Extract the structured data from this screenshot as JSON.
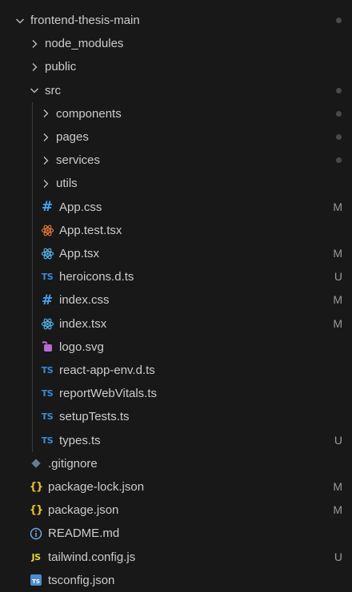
{
  "explorer": {
    "colors": {
      "background": "#181818",
      "text": "#cccccc",
      "badge": "#9a9a9a",
      "dot": "#4a4a4a",
      "css_icon": "#42a5f5",
      "react_icon": "#52b7e8",
      "test_icon": "#e8773b",
      "ts_icon": "#3a8ad8",
      "json_icon": "#e6c232",
      "svg_icon": "#b76ad2",
      "git_icon": "#6a7c8c",
      "js_icon": "#e8d43a",
      "info_icon": "#6fa8dc",
      "tsconfig_icon": "#4a8ccf"
    },
    "items": [
      {
        "label": "frontend-thesis-main",
        "kind": "folder-open",
        "icon": "chevron-down-icon",
        "depth": 0,
        "dot": true
      },
      {
        "label": "node_modules",
        "kind": "folder",
        "icon": "chevron-right-icon",
        "depth": 1
      },
      {
        "label": "public",
        "kind": "folder",
        "icon": "chevron-right-icon",
        "depth": 1
      },
      {
        "label": "src",
        "kind": "folder-open",
        "icon": "chevron-down-icon",
        "depth": 1,
        "dot": true
      },
      {
        "label": "components",
        "kind": "folder",
        "icon": "chevron-right-icon",
        "depth": 2,
        "dot": true
      },
      {
        "label": "pages",
        "kind": "folder",
        "icon": "chevron-right-icon",
        "depth": 2,
        "dot": true
      },
      {
        "label": "services",
        "kind": "folder",
        "icon": "chevron-right-icon",
        "depth": 2,
        "dot": true
      },
      {
        "label": "utils",
        "kind": "folder",
        "icon": "chevron-right-icon",
        "depth": 2
      },
      {
        "label": "App.css",
        "kind": "file",
        "icon": "css-hash-icon",
        "glyph": "#",
        "depth": 2,
        "badge": "M"
      },
      {
        "label": "App.test.tsx",
        "kind": "file",
        "icon": "react-test-icon",
        "glyph": "",
        "depth": 2
      },
      {
        "label": "App.tsx",
        "kind": "file",
        "icon": "react-icon",
        "glyph": "",
        "depth": 2,
        "badge": "M"
      },
      {
        "label": "heroicons.d.ts",
        "kind": "file",
        "icon": "typescript-icon",
        "glyph": "TS",
        "depth": 2,
        "badge": "U"
      },
      {
        "label": "index.css",
        "kind": "file",
        "icon": "css-hash-icon",
        "glyph": "#",
        "depth": 2,
        "badge": "M"
      },
      {
        "label": "index.tsx",
        "kind": "file",
        "icon": "react-icon",
        "glyph": "",
        "depth": 2,
        "badge": "M"
      },
      {
        "label": "logo.svg",
        "kind": "file",
        "icon": "svg-file-icon",
        "glyph": "",
        "depth": 2
      },
      {
        "label": "react-app-env.d.ts",
        "kind": "file",
        "icon": "typescript-icon",
        "glyph": "TS",
        "depth": 2
      },
      {
        "label": "reportWebVitals.ts",
        "kind": "file",
        "icon": "typescript-icon",
        "glyph": "TS",
        "depth": 2
      },
      {
        "label": "setupTests.ts",
        "kind": "file",
        "icon": "typescript-icon",
        "glyph": "TS",
        "depth": 2
      },
      {
        "label": "types.ts",
        "kind": "file",
        "icon": "typescript-icon",
        "glyph": "TS",
        "depth": 2,
        "badge": "U"
      },
      {
        "label": ".gitignore",
        "kind": "file",
        "icon": "git-diamond-icon",
        "glyph": "",
        "depth": 1
      },
      {
        "label": "package-lock.json",
        "kind": "file",
        "icon": "json-braces-icon",
        "glyph": "{}",
        "depth": 1,
        "badge": "M"
      },
      {
        "label": "package.json",
        "kind": "file",
        "icon": "json-braces-icon",
        "glyph": "{}",
        "depth": 1,
        "badge": "M"
      },
      {
        "label": "README.md",
        "kind": "file",
        "icon": "info-circle-icon",
        "glyph": "",
        "depth": 1
      },
      {
        "label": "tailwind.config.js",
        "kind": "file",
        "icon": "javascript-icon",
        "glyph": "JS",
        "depth": 1,
        "badge": "U"
      },
      {
        "label": "tsconfig.json",
        "kind": "file",
        "icon": "tsconfig-icon",
        "glyph": "TS",
        "depth": 1
      }
    ]
  }
}
